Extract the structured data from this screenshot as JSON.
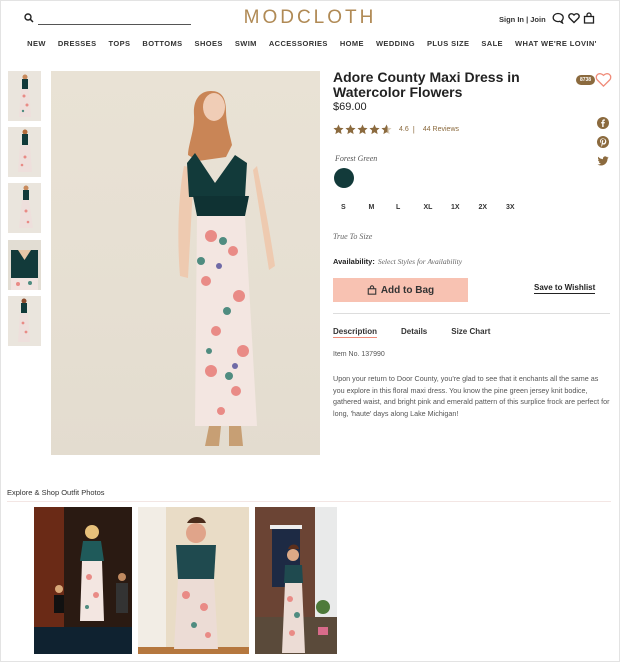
{
  "header": {
    "logo": "MODCLOTH",
    "search": {
      "placeholder": ""
    },
    "account": "Sign In | Join",
    "icons": [
      "search-icon",
      "chat-icon",
      "heart-icon",
      "bag-icon"
    ]
  },
  "nav": [
    "NEW",
    "DRESSES",
    "TOPS",
    "BOTTOMS",
    "SHOES",
    "SWIM",
    "ACCESSORIES",
    "HOME",
    "WEDDING",
    "PLUS SIZE",
    "SALE",
    "WHAT WE'RE LOVIN'"
  ],
  "gallery": {
    "thumbnails": [
      "front-view",
      "back-view",
      "side-view",
      "bodice-detail",
      "full-length"
    ],
    "main": "model-front-view"
  },
  "product": {
    "title": "Adore County Maxi Dress in Watercolor Flowers",
    "price": "$69.00",
    "rating": {
      "value": "4.6",
      "stars": 4.6,
      "reviews": "44 Reviews"
    },
    "favorite_count": "8738",
    "color": {
      "label": "Forest Green",
      "hex": "#123a3a"
    },
    "sizes": [
      "S",
      "M",
      "L",
      "XL",
      "1X",
      "2X",
      "3X"
    ],
    "fit": "True To Size",
    "availability": {
      "label": "Availability:",
      "value": "Select Styles for Availability"
    },
    "add_to_bag": "Add to Bag",
    "save_wishlist": "Save to Wishlist",
    "tabs": [
      {
        "label": "Description",
        "active": true
      },
      {
        "label": "Details",
        "active": false
      },
      {
        "label": "Size Chart",
        "active": false
      }
    ],
    "item_no": "Item No. 137990",
    "description": "Upon your return to Door County, you're glad to see that it enchants all the same as you explore in this floral maxi dress. You know the pine green jersey knit bodice, gathered waist, and bright pink and emerald pattern of this surplice frock are perfect for long, 'haute' days along Lake Michigan!"
  },
  "social": [
    "facebook-icon",
    "pinterest-icon",
    "twitter-icon"
  ],
  "outfits": {
    "title": "Explore & Shop Outfit Photos",
    "photos": [
      "customer-photo-stage",
      "customer-photo-bedroom",
      "customer-photo-porch"
    ]
  },
  "colors": {
    "accent": "#b08a55",
    "star": "#8b6a3e",
    "button": "#f8c2b2",
    "tab_underline": "#f08c7a"
  }
}
